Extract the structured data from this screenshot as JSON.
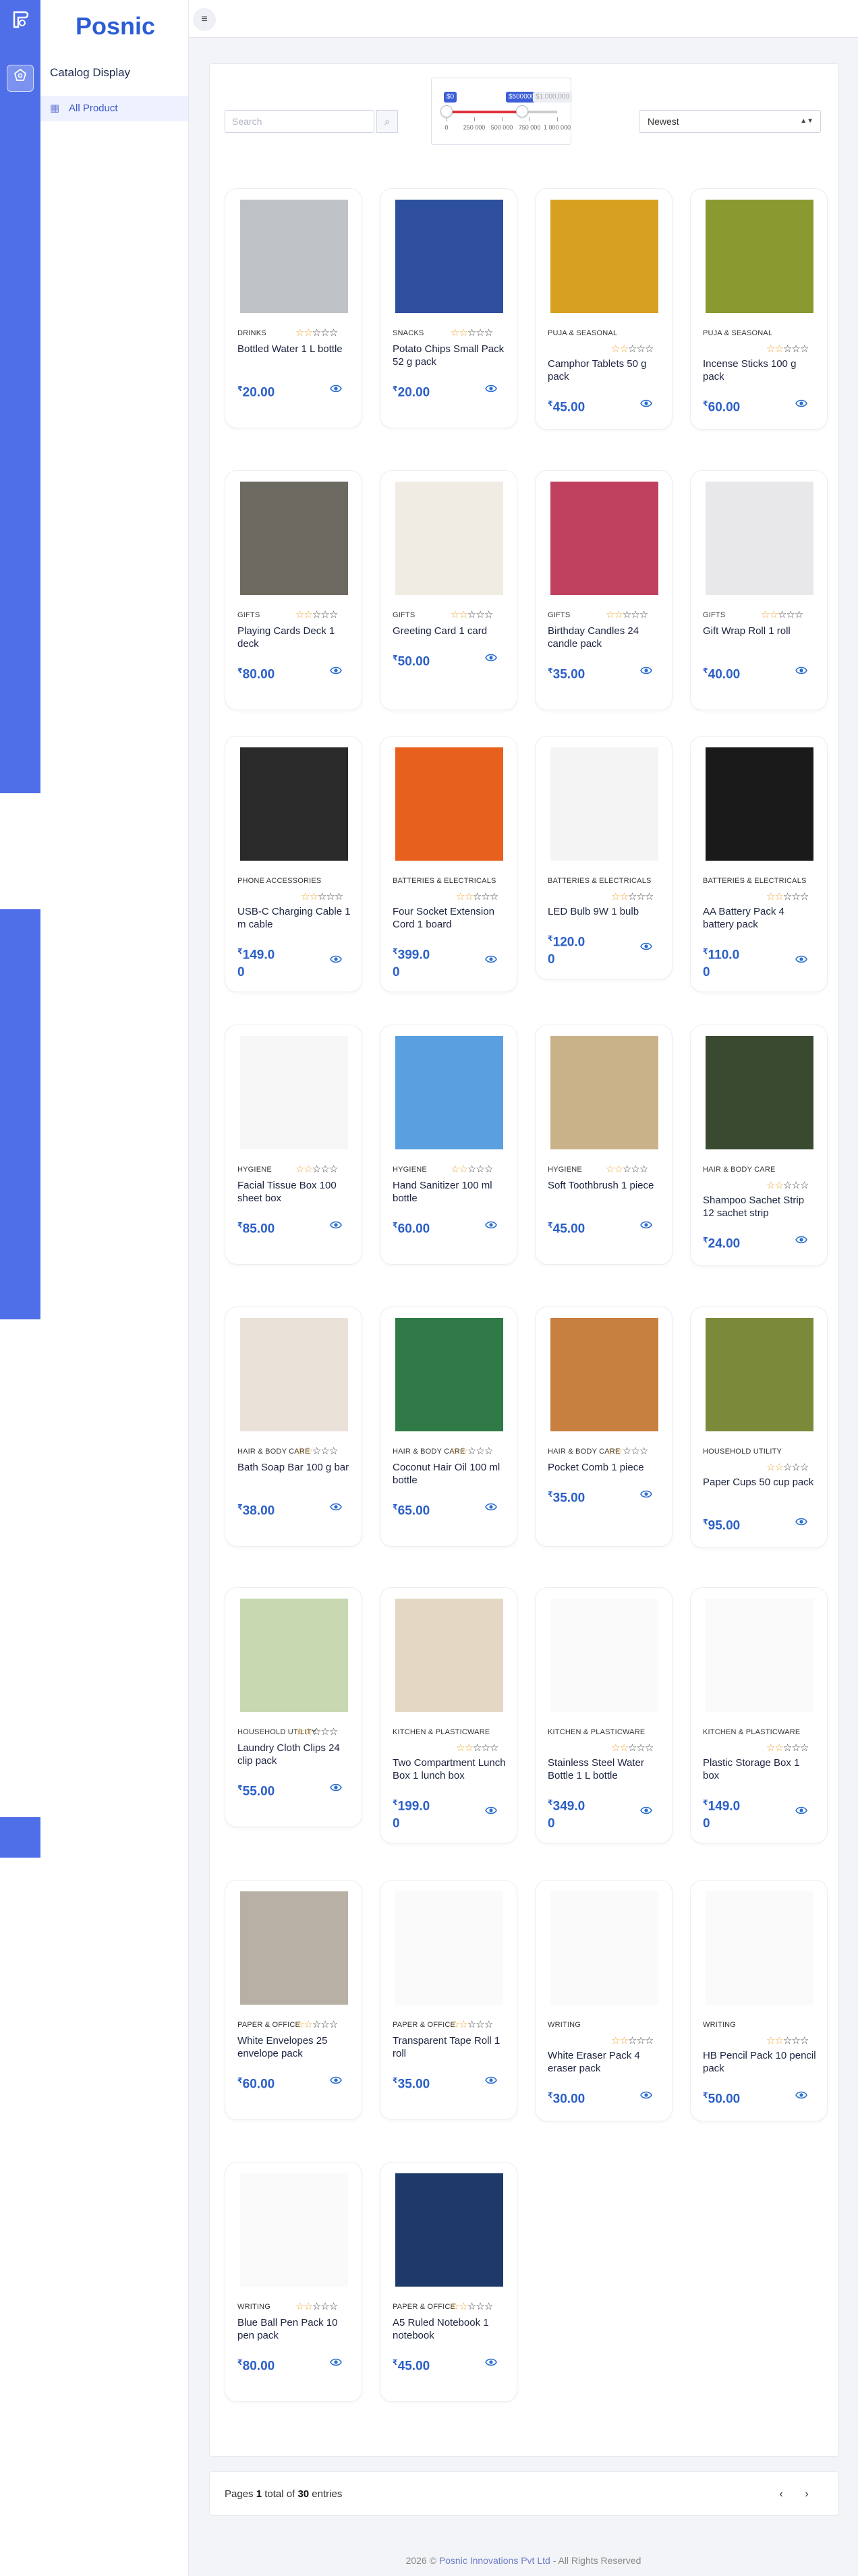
{
  "app": {
    "brand": "Posnic",
    "sidebar_title": "Catalog Display",
    "nav_item": "All Product"
  },
  "toolbar": {
    "search_placeholder": "Search",
    "sort_value": "Newest",
    "price_range": {
      "min_tag": "$0",
      "value_tag": "$500000",
      "max_tag": "$1,000,000",
      "scale": [
        "0",
        "250 000",
        "500 000",
        "750 000",
        "1 000 000"
      ],
      "selected_min": 0,
      "selected_max": 500000
    }
  },
  "colors": {
    "accent": "#2b5fc8",
    "rail": "#4f6fe8",
    "star": "#f0a531"
  },
  "products": [
    {
      "category": "DRINKS",
      "name": "Bottled Water 1 L bottle",
      "price_int": "20.00",
      "rating": 2
    },
    {
      "category": "SNACKS",
      "name": "Potato Chips Small Pack 52 g pack",
      "price_int": "20.00",
      "rating": 2
    },
    {
      "category": "PUJA & SEASONAL",
      "name": "Camphor Tablets 50 g pack",
      "price_int": "45.00",
      "rating": 2
    },
    {
      "category": "PUJA & SEASONAL",
      "name": "Incense Sticks 100 g pack",
      "price_int": "60.00",
      "rating": 2
    },
    {
      "category": "GIFTS",
      "name": "Playing Cards Deck 1 deck",
      "price_int": "80.00",
      "rating": 2
    },
    {
      "category": "GIFTS",
      "name": "Greeting Card 1 card",
      "price_int": "50.00",
      "rating": 2
    },
    {
      "category": "GIFTS",
      "name": "Birthday Candles 24 candle pack",
      "price_int": "35.00",
      "rating": 2
    },
    {
      "category": "GIFTS",
      "name": "Gift Wrap Roll 1 roll",
      "price_int": "40.00",
      "rating": 2
    },
    {
      "category": "PHONE ACCESSORIES",
      "name": "USB-C Charging Cable 1 m cable",
      "price_int": "149.0",
      "price_tail": "0",
      "rating": 2
    },
    {
      "category": "BATTERIES & ELECTRICALS",
      "name": "Four Socket Extension Cord 1 board",
      "price_int": "399.0",
      "price_tail": "0",
      "rating": 2
    },
    {
      "category": "BATTERIES & ELECTRICALS",
      "name": "LED Bulb 9W 1 bulb",
      "price_int": "120.0",
      "price_tail": "0",
      "rating": 2
    },
    {
      "category": "BATTERIES & ELECTRICALS",
      "name": "AA Battery Pack 4 battery pack",
      "price_int": "110.0",
      "price_tail": "0",
      "rating": 2
    },
    {
      "category": "HYGIENE",
      "name": "Facial Tissue Box 100 sheet box",
      "price_int": "85.00",
      "rating": 2
    },
    {
      "category": "HYGIENE",
      "name": "Hand Sanitizer 100 ml bottle",
      "price_int": "60.00",
      "rating": 2
    },
    {
      "category": "HYGIENE",
      "name": "Soft Toothbrush 1 piece",
      "price_int": "45.00",
      "rating": 2
    },
    {
      "category": "HAIR & BODY CARE",
      "name": "Shampoo Sachet Strip 12 sachet strip",
      "price_int": "24.00",
      "rating": 2
    },
    {
      "category": "HAIR & BODY CARE",
      "name": "Bath Soap Bar 100 g bar",
      "price_int": "38.00",
      "rating": 2
    },
    {
      "category": "HAIR & BODY CARE",
      "name": "Coconut Hair Oil 100 ml bottle",
      "price_int": "65.00",
      "rating": 2
    },
    {
      "category": "HAIR & BODY CARE",
      "name": "Pocket Comb 1 piece",
      "price_int": "35.00",
      "rating": 2
    },
    {
      "category": "HOUSEHOLD UTILITY",
      "name": "Paper Cups 50 cup pack",
      "price_int": "95.00",
      "rating": 2
    },
    {
      "category": "HOUSEHOLD UTILITY",
      "name": "Laundry Cloth Clips 24 clip pack",
      "price_int": "55.00",
      "rating": 2
    },
    {
      "category": "KITCHEN & PLASTICWARE",
      "name": "Two Compartment Lunch Box 1 lunch box",
      "price_int": "199.0",
      "price_tail": "0",
      "rating": 2
    },
    {
      "category": "KITCHEN & PLASTICWARE",
      "name": "Stainless Steel Water Bottle 1 L bottle",
      "price_int": "349.0",
      "price_tail": "0",
      "rating": 2
    },
    {
      "category": "KITCHEN & PLASTICWARE",
      "name": "Plastic Storage Box 1 box",
      "price_int": "149.0",
      "price_tail": "0",
      "rating": 2
    },
    {
      "category": "PAPER & OFFICE",
      "name": "White Envelopes 25 envelope pack",
      "price_int": "60.00",
      "rating": 2
    },
    {
      "category": "PAPER & OFFICE",
      "name": "Transparent Tape Roll 1 roll",
      "price_int": "35.00",
      "rating": 2
    },
    {
      "category": "WRITING",
      "name": "White Eraser Pack 4 eraser pack",
      "price_int": "30.00",
      "rating": 2
    },
    {
      "category": "WRITING",
      "name": "HB Pencil Pack 10 pencil pack",
      "price_int": "50.00",
      "rating": 2
    },
    {
      "category": "WRITING",
      "name": "Blue Ball Pen Pack 10 pen pack",
      "price_int": "80.00",
      "rating": 2
    },
    {
      "category": "PAPER & OFFICE",
      "name": "A5 Ruled Notebook 1 notebook",
      "price_int": "45.00",
      "rating": 2
    }
  ],
  "pagination": {
    "pages_label": "Pages",
    "current": "1",
    "total_label": "total of",
    "total": "30",
    "entries_label": "entries"
  },
  "footer": {
    "year": "2026 ©",
    "company": "Posnic Innovations Pvt Ltd",
    "rights": "- All Rights Reserved"
  }
}
